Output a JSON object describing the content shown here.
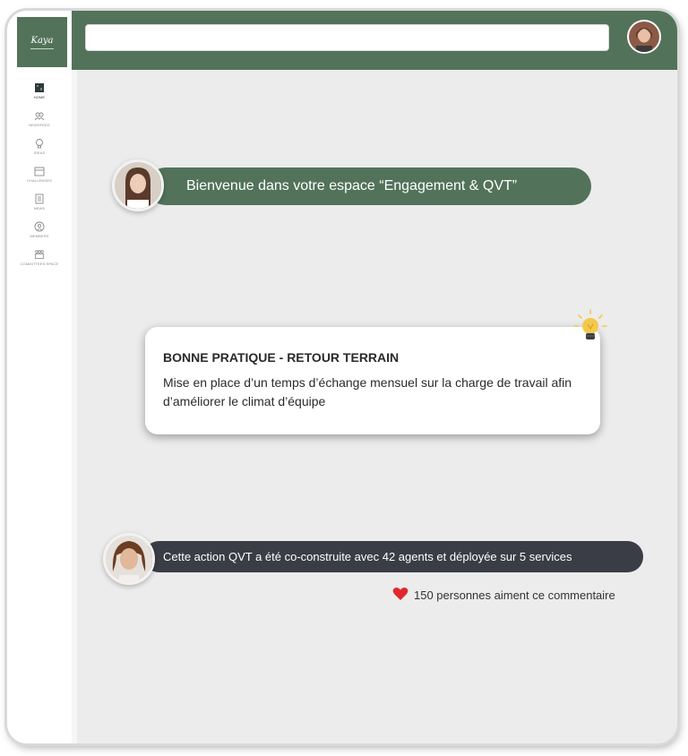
{
  "app": {
    "logo_text": "Kaya"
  },
  "sidebar": {
    "items": [
      {
        "label": "HOME",
        "icon": "home-icon"
      },
      {
        "label": "NEWSFEED",
        "icon": "newsfeed-icon"
      },
      {
        "label": "IDEAS",
        "icon": "lightbulb-icon"
      },
      {
        "label": "CHALLENGES",
        "icon": "calendar-icon"
      },
      {
        "label": "NEWS",
        "icon": "news-icon"
      },
      {
        "label": "MEMBERS",
        "icon": "members-icon"
      },
      {
        "label": "COMMITTEES SPACE",
        "icon": "committees-icon"
      }
    ]
  },
  "header": {
    "search_value": ""
  },
  "welcome": {
    "text": "Bienvenue dans votre espace “Engagement & QVT”"
  },
  "card": {
    "title": "BONNE PRATIQUE - RETOUR TERRAIN",
    "text": "Mise en place d’un temps d’échange mensuel sur la charge de travail afin d’améliorer le climat d’équipe"
  },
  "comment": {
    "text": "Cette action QVT a été co-construite avec 42 agents et déployée sur 5 services",
    "likes_text": "150 personnes aiment ce commentaire"
  },
  "colors": {
    "brand_green": "#52735a",
    "comment_dark": "#3a3d45",
    "background": "#ececec"
  }
}
